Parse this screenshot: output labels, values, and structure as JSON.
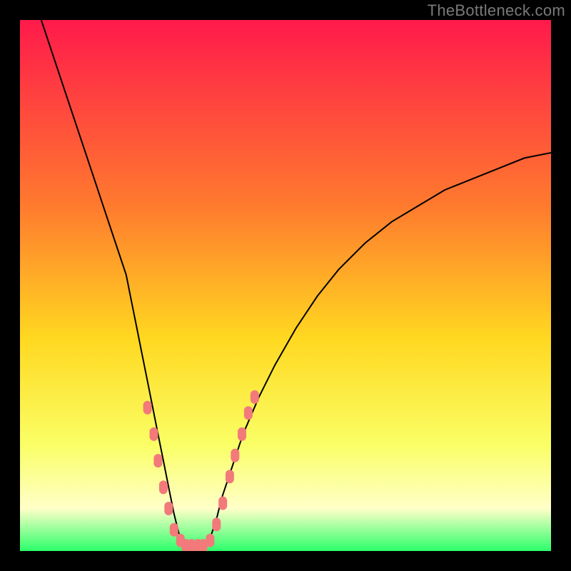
{
  "branding": {
    "watermark": "TheBottleneck.com"
  },
  "colors": {
    "frame": "#000000",
    "watermark": "#7a7a7a",
    "gradient_top": "#ff1a4b",
    "gradient_mid_upper": "#ff7a2e",
    "gradient_mid": "#ffd820",
    "gradient_lower": "#faff66",
    "gradient_pale": "#ffffc8",
    "gradient_bottom": "#2bff6a",
    "curve": "#000000",
    "marker_fill": "#f27a7a",
    "marker_stroke": "#f27a7a"
  },
  "chart_data": {
    "type": "line",
    "title": "",
    "xlabel": "",
    "ylabel": "",
    "xlim": [
      0,
      100
    ],
    "ylim": [
      0,
      100
    ],
    "x": [
      4,
      6,
      8,
      10,
      12,
      14,
      16,
      18,
      20,
      21,
      22,
      23,
      24,
      25,
      26,
      27,
      28,
      29,
      30,
      31,
      32,
      33,
      34,
      35,
      36,
      37,
      38,
      40,
      42,
      45,
      48,
      52,
      56,
      60,
      65,
      70,
      75,
      80,
      85,
      90,
      95,
      100
    ],
    "y": [
      100,
      94,
      88,
      82,
      76,
      70,
      64,
      58,
      52,
      47,
      42,
      37,
      32,
      27,
      22,
      17,
      12,
      7,
      3,
      1,
      0,
      0,
      0,
      1,
      3,
      6,
      10,
      16,
      22,
      29,
      35,
      42,
      48,
      53,
      58,
      62,
      65,
      68,
      70,
      72,
      74,
      75
    ],
    "markers": {
      "x": [
        24.0,
        25.2,
        26.0,
        27.0,
        28.0,
        29.0,
        30.2,
        31.2,
        32.3,
        33.5,
        34.5,
        35.8,
        37.0,
        38.2,
        39.5,
        40.5,
        41.8,
        43.0,
        44.2
      ],
      "y": [
        27,
        22,
        17,
        12,
        8,
        4,
        2,
        1,
        1,
        1,
        1,
        2,
        5,
        9,
        14,
        18,
        22,
        26,
        29
      ]
    }
  }
}
